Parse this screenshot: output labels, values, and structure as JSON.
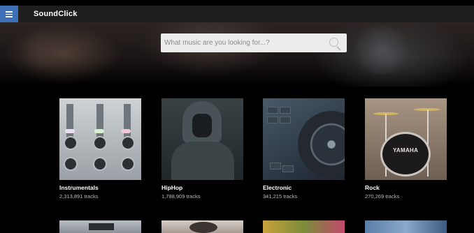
{
  "header": {
    "app_title": "SoundClick",
    "menu_icon": "hamburger-menu-icon"
  },
  "search": {
    "placeholder": "What music are you looking for...?",
    "icon": "search-icon"
  },
  "genres": [
    {
      "title": "Instrumentals",
      "count": "2,313,891 tracks"
    },
    {
      "title": "HipHop",
      "count": "1,788,909 tracks"
    },
    {
      "title": "Electronic",
      "count": "341,215 tracks"
    },
    {
      "title": "Rock",
      "count": "270,269 tracks"
    }
  ],
  "thumbnail_texts": {
    "rock_drum_logo": "YAMAHA"
  },
  "colors": {
    "menu_button": "#3d6fb6",
    "topbar": "#1e1e1e",
    "background": "#000000",
    "search_box": "#ececec"
  }
}
